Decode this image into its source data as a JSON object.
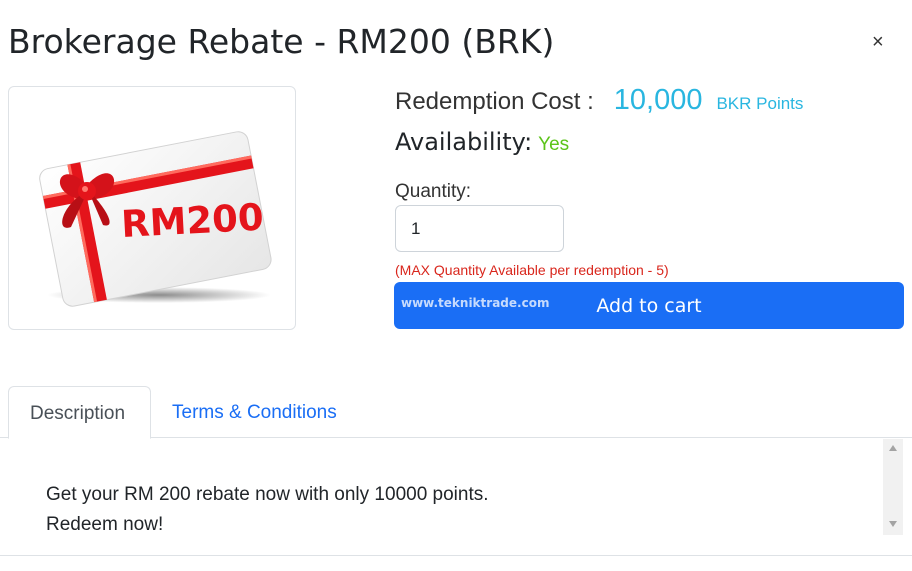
{
  "modal": {
    "title": "Brokerage Rebate - RM200 (BRK)",
    "close_symbol": "×"
  },
  "product": {
    "image_text": "RM200",
    "redemption_cost_label": "Redemption Cost :",
    "redemption_cost_value": "10,000",
    "redemption_cost_unit": "BKR Points",
    "availability_label": "Availability:",
    "availability_value": "Yes",
    "quantity_label": "Quantity:",
    "quantity_value": "1",
    "max_note": "(MAX Quantity Available per redemption - 5)",
    "add_to_cart_label": "Add to cart",
    "watermark": "www.tekniktrade.com"
  },
  "tabs": [
    {
      "label": "Description",
      "active": true
    },
    {
      "label": "Terms & Conditions",
      "active": false
    }
  ],
  "description": {
    "line1": "Get your RM 200 rebate now with only 10000 points.",
    "line2": "Redeem now!"
  },
  "colors": {
    "accent_blue": "#1a6ef5",
    "points_blue": "#29b6e0",
    "availability_green": "#5cc41a",
    "note_red": "#d9261c",
    "ribbon_red": "#e4141b"
  }
}
